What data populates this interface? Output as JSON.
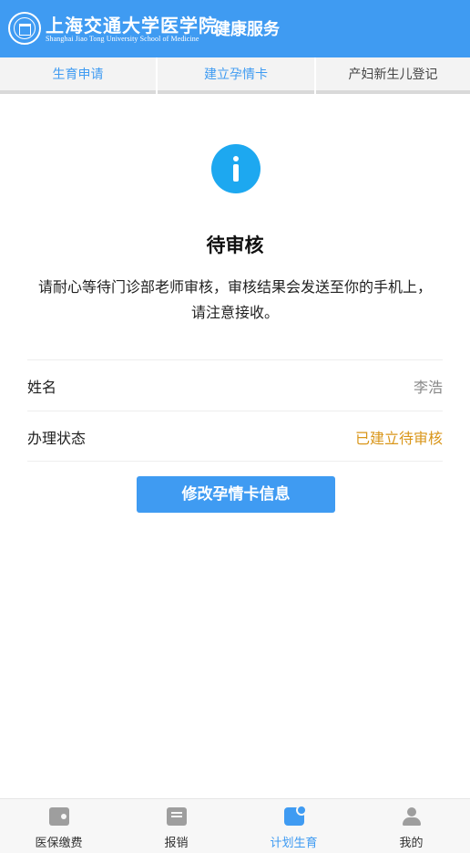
{
  "header": {
    "logo_cn": "上海交通大学医学院",
    "logo_en": "Shanghai Jiao Tong University School of Medicine",
    "title": "健康服务"
  },
  "tabs": [
    {
      "label": "生育申请",
      "active": true
    },
    {
      "label": "建立孕情卡",
      "active": true
    },
    {
      "label": "产妇新生儿登记",
      "active": false
    }
  ],
  "status": {
    "icon": "info-icon",
    "title": "待审核",
    "description": "请耐心等待门诊部老师审核，审核结果会发送至你的手机上，请注意接收。"
  },
  "info_rows": [
    {
      "label": "姓名",
      "value": "李浩"
    },
    {
      "label": "办理状态",
      "value": "已建立待审核"
    }
  ],
  "edit_button_label": "修改孕情卡信息",
  "bottom_nav": [
    {
      "label": "医保缴费",
      "icon": "wallet-icon"
    },
    {
      "label": "报销",
      "icon": "receipt-icon"
    },
    {
      "label": "计划生育",
      "icon": "plan-icon",
      "active": true
    },
    {
      "label": "我的",
      "icon": "person-icon"
    }
  ],
  "colors": {
    "primary": "#3f9bf2",
    "info": "#1da8f0",
    "pending_status": "#d9961a"
  }
}
